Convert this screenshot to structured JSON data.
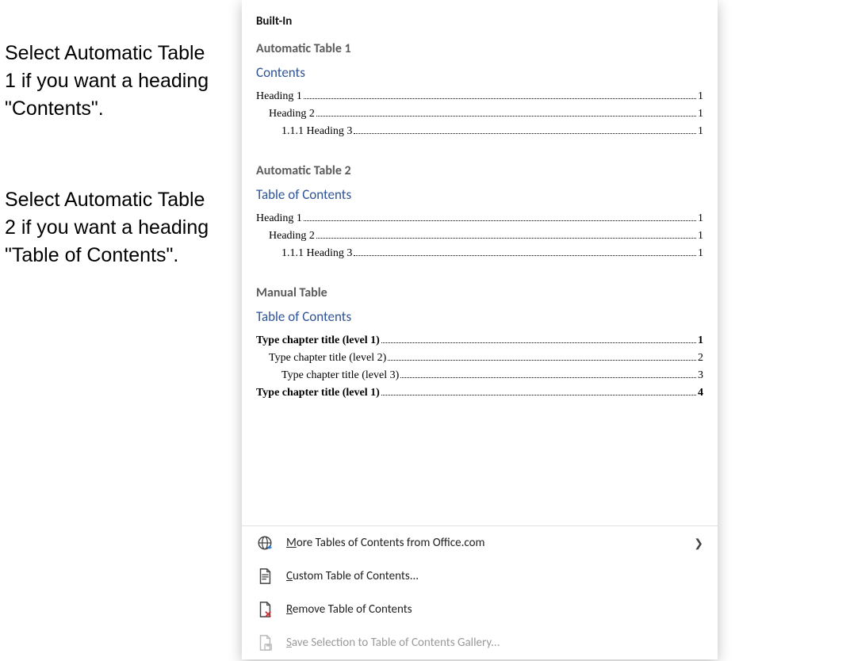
{
  "annotations": {
    "note1": "Select Automatic Table 1 if you want a heading \"Contents\".",
    "note2": "Select Automatic Table 2 if you want a heading \"Table of Contents\"."
  },
  "category_label": "Built-In",
  "items": {
    "auto1": {
      "name": "Automatic Table 1",
      "title": "Contents",
      "rows": [
        {
          "level": 1,
          "label": "Heading 1",
          "page": "1",
          "bold": false
        },
        {
          "level": 2,
          "label": "Heading 2",
          "page": "1",
          "bold": false
        },
        {
          "level": 3,
          "label": "1.1.1    Heading 3",
          "page": "1",
          "bold": false
        }
      ]
    },
    "auto2": {
      "name": "Automatic Table 2",
      "title": "Table of Contents",
      "rows": [
        {
          "level": 1,
          "label": "Heading 1",
          "page": "1",
          "bold": false
        },
        {
          "level": 2,
          "label": "Heading 2",
          "page": "1",
          "bold": false
        },
        {
          "level": 3,
          "label": "1.1.1    Heading 3",
          "page": "1",
          "bold": false
        }
      ]
    },
    "manual": {
      "name": "Manual Table",
      "title": "Table of Contents",
      "rows": [
        {
          "level": 1,
          "label": "Type chapter title (level 1)",
          "page": "1",
          "bold": true
        },
        {
          "level": 2,
          "label": "Type chapter title (level 2)",
          "page": "2",
          "bold": false
        },
        {
          "level": 3,
          "label": "Type chapter title (level 3)",
          "page": "3",
          "bold": false
        },
        {
          "level": 1,
          "label": "Type chapter title (level 1)",
          "page": "4",
          "bold": true
        }
      ]
    }
  },
  "commands": {
    "more": "More Tables of Contents from Office.com",
    "custom": "Custom Table of Contents...",
    "remove": "Remove Table of Contents",
    "save": "Save Selection to Table of Contents Gallery..."
  }
}
